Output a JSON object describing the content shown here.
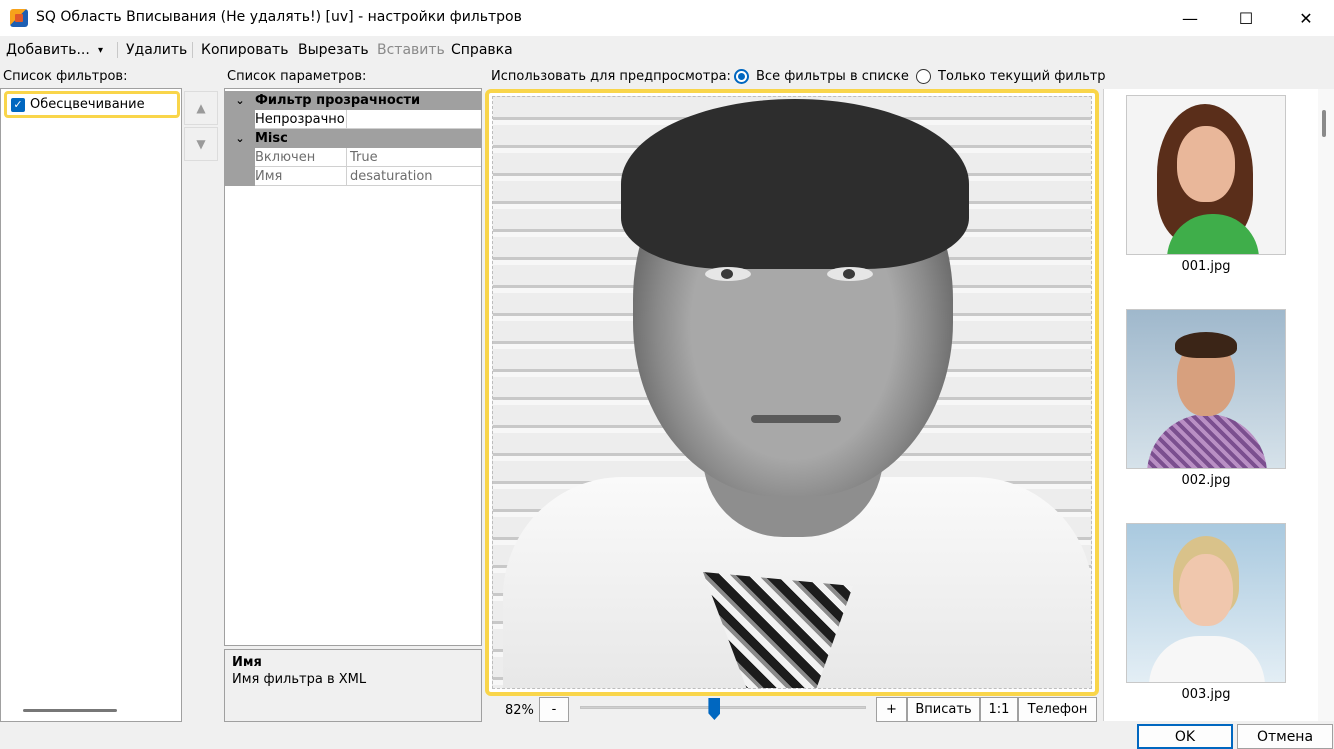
{
  "window": {
    "title": "SQ Область Вписывания (Не удалять!) [uv] - настройки фильтров",
    "minimize_glyph": "—",
    "maximize_glyph": "☐",
    "close_glyph": "✕"
  },
  "menu": {
    "add": "Добавить...",
    "add_arrow": "▾",
    "delete": "Удалить",
    "copy": "Копировать",
    "cut": "Вырезать",
    "paste": "Вставить",
    "help": "Справка"
  },
  "filters": {
    "label": "Список фильтров:",
    "items": [
      {
        "label": "Обесцвечивание",
        "checked": true,
        "check_glyph": "✓"
      }
    ],
    "up_glyph": "▲",
    "down_glyph": "▼"
  },
  "params": {
    "label": "Список параметров:",
    "categories": [
      {
        "title": "Фильтр прозрачности",
        "chevron": "⌄",
        "props": [
          {
            "name": "Непрозрачно",
            "value": ""
          }
        ]
      },
      {
        "title": "Misc",
        "chevron": "⌄",
        "props": [
          {
            "name": "Включен",
            "value": "True"
          },
          {
            "name": "Имя",
            "value": "desaturation"
          }
        ]
      }
    ],
    "description": {
      "title": "Имя",
      "text": "Имя фильтра в XML"
    }
  },
  "preview": {
    "label": "Использовать для предпросмотра:",
    "options": [
      {
        "label": "Все фильтры в списке",
        "selected": true
      },
      {
        "label": "Только текущий фильтр",
        "selected": false
      }
    ],
    "zoom": {
      "value": "82%",
      "level": 0.47,
      "minus": "-",
      "plus": "+",
      "fit": "Вписать",
      "one_to_one": "1:1",
      "phone": "Телефон"
    }
  },
  "thumbnails": [
    {
      "caption": "001.jpg"
    },
    {
      "caption": "002.jpg"
    },
    {
      "caption": "003.jpg"
    }
  ],
  "buttons": {
    "ok": "OK",
    "cancel": "Отмена"
  },
  "colors": {
    "accent": "#0067c0",
    "highlight": "#f9d54a"
  }
}
